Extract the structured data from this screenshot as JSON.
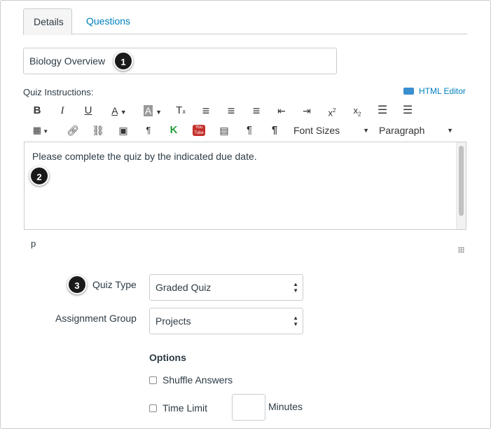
{
  "tabs": [
    {
      "label": "Details"
    },
    {
      "label": "Questions"
    }
  ],
  "quiz_title": {
    "value": "Biology Overview"
  },
  "callouts": [
    "1",
    "2",
    "3"
  ],
  "instructions": {
    "label": "Quiz Instructions:",
    "html_editor_label": "HTML Editor",
    "content": "Please complete the quiz by the indicated due date.",
    "path": "p"
  },
  "toolbar_row1": [
    "B",
    "I",
    "U",
    "A ▾",
    "A ▾",
    "T",
    "≡",
    "≡",
    "≡",
    "⇤",
    "⇥",
    "x²",
    "x₂",
    "☰",
    "☰"
  ],
  "toolbar_row2": {
    "font_sizes_label": "Font Sizes",
    "paragraph_label": "Paragraph"
  },
  "quiz_type": {
    "label": "Quiz Type",
    "value": "Graded Quiz"
  },
  "assignment_group": {
    "label": "Assignment Group",
    "value": "Projects"
  },
  "options": {
    "title": "Options",
    "shuffle_answers": "Shuffle Answers",
    "time_limit": "Time Limit",
    "minutes_label": "Minutes"
  },
  "colors": {
    "link": "#0081bd",
    "badge": "#1a1a1a",
    "border": "#c7cdd1"
  }
}
